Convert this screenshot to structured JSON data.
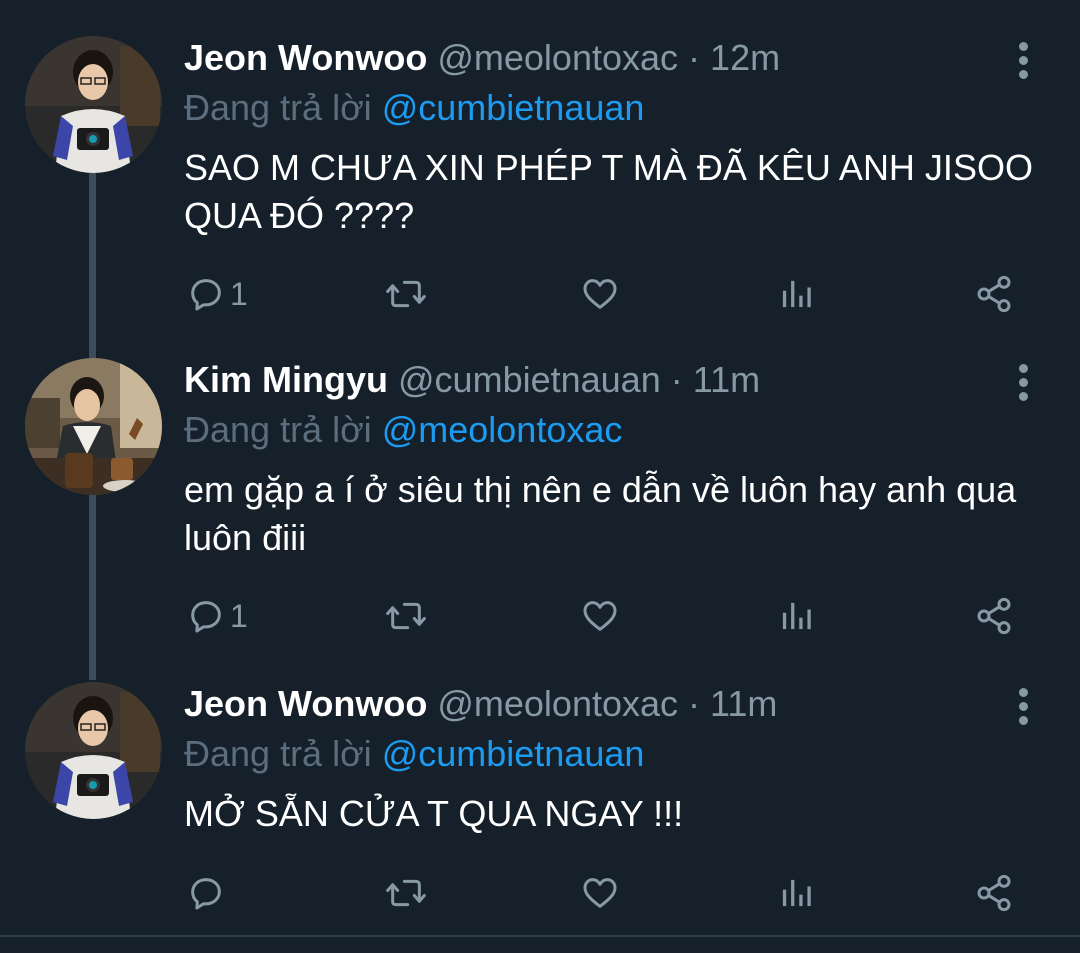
{
  "tweets": [
    {
      "author_name": "Jeon Wonwoo",
      "author_handle": "@meolontoxac",
      "separator": "·",
      "time": "12m",
      "replying_prefix": "Đang trả lời",
      "replying_to": "@cumbietnauan",
      "text": "SAO M CHƯA XIN PHÉP T MÀ ĐÃ KÊU ANH JISOO QUA ĐÓ ????",
      "reply_count": "1"
    },
    {
      "author_name": "Kim Mingyu",
      "author_handle": "@cumbietnauan",
      "separator": "·",
      "time": "11m",
      "replying_prefix": "Đang trả lời",
      "replying_to": "@meolontoxac",
      "text": "em gặp a í ở siêu thị nên e dẫn về luôn hay anh qua luôn điii",
      "reply_count": "1"
    },
    {
      "author_name": "Jeon Wonwoo",
      "author_handle": "@meolontoxac",
      "separator": "·",
      "time": "11m",
      "replying_prefix": "Đang trả lời",
      "replying_to": "@cumbietnauan",
      "text": "MỞ SẴN CỬA T QUA NGAY !!!",
      "reply_count": ""
    }
  ],
  "icons": {
    "reply": "reply-icon",
    "retweet": "retweet-icon",
    "like": "heart-icon",
    "analytics": "analytics-icon",
    "share": "share-icon",
    "more": "more-vertical-icon"
  },
  "colors": {
    "background": "#15202b",
    "primary_text": "#ffffff",
    "secondary_text": "#8899a6",
    "link": "#1d9bf0",
    "thread_line": "#3d4c5b"
  }
}
